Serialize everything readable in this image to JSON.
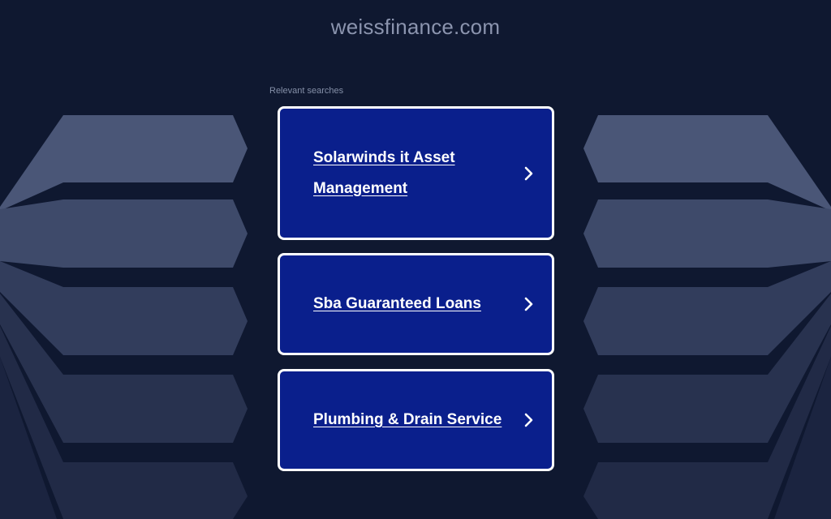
{
  "header": {
    "domain": "weissfinance.com"
  },
  "main": {
    "relevant_label": "Relevant searches",
    "links": [
      {
        "label": "Solarwinds it Asset Management"
      },
      {
        "label": "Sba Guaranteed Loans"
      },
      {
        "label": "Plumbing & Drain Service"
      }
    ]
  },
  "icons": {
    "link_arrow": "chevron-right-icon"
  },
  "colors": {
    "background": "#0f1830",
    "card": "#0a1f8c",
    "card_border": "#ffffff",
    "title_text": "#8b94ae"
  }
}
